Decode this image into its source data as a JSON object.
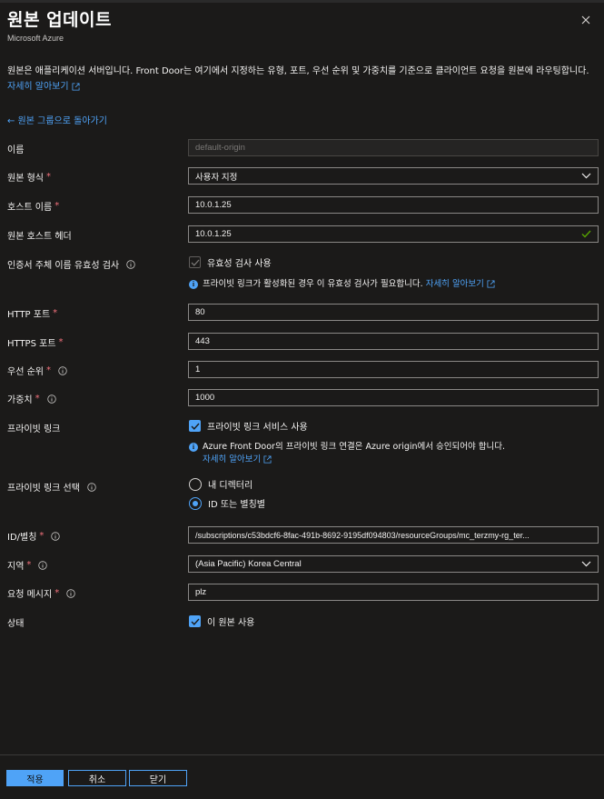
{
  "header": {
    "title": "원본 업데이트",
    "subtitle": "Microsoft Azure"
  },
  "description": {
    "text": "원본은 애플리케이션 서버입니다. Front Door는 여기에서 지정하는 유형, 포트, 우선 순위 및 가중치를 기준으로 클라이언트 요청을 원본에 라우팅합니다.",
    "learn_more": "자세히 알아보기"
  },
  "back_link": "← 원본 그룹으로 돌아가기",
  "form": {
    "name": {
      "label": "이름",
      "placeholder": "default-origin"
    },
    "origin_type": {
      "label": "원본 형식",
      "value": "사용자 지정"
    },
    "host_name": {
      "label": "호스트 이름",
      "value": "10.0.1.25"
    },
    "origin_host_header": {
      "label": "원본 호스트 헤더",
      "value": "10.0.1.25"
    },
    "cert_check": {
      "label": "인증서 주체 이름 유효성 검사",
      "checkbox_label": "유효성 검사 사용",
      "checked": true,
      "disabled": true,
      "info": "프라이빗 링크가 활성화된 경우 이 유효성 검사가 필요합니다.",
      "info_link": "자세히 알아보기"
    },
    "http_port": {
      "label": "HTTP 포트",
      "value": "80"
    },
    "https_port": {
      "label": "HTTPS 포트",
      "value": "443"
    },
    "priority": {
      "label": "우선 순위",
      "value": "1"
    },
    "weight": {
      "label": "가중치",
      "value": "1000"
    },
    "private_link": {
      "label": "프라이빗 링크",
      "checkbox_label": "프라이빗 링크 서비스 사용",
      "checked": true,
      "info": "Azure Front Door의 프라이빗 링크 연결은 Azure origin에서 승인되어야 합니다.",
      "info_link": "자세히 알아보기"
    },
    "private_link_select": {
      "label": "프라이빗 링크 선택",
      "options": [
        "내 디렉터리",
        "ID 또는 별칭별"
      ],
      "selected": "ID 또는 별칭별"
    },
    "id_alias": {
      "label": "ID/별칭",
      "value": "/subscriptions/c53bdcf6-8fac-491b-8692-9195df094803/resourceGroups/mc_terzmy-rg_ter..."
    },
    "region": {
      "label": "지역",
      "value": "(Asia Pacific) Korea Central"
    },
    "request_message": {
      "label": "요청 메시지",
      "value": "plz"
    },
    "status": {
      "label": "상태",
      "checkbox_label": "이 원본 사용",
      "checked": true
    }
  },
  "footer": {
    "apply": "적용",
    "cancel": "취소",
    "close": "닫기"
  },
  "colors": {
    "background": "#1b1a19",
    "accent": "#4fa3f7",
    "required": "#f1707b",
    "valid": "#57a300"
  }
}
